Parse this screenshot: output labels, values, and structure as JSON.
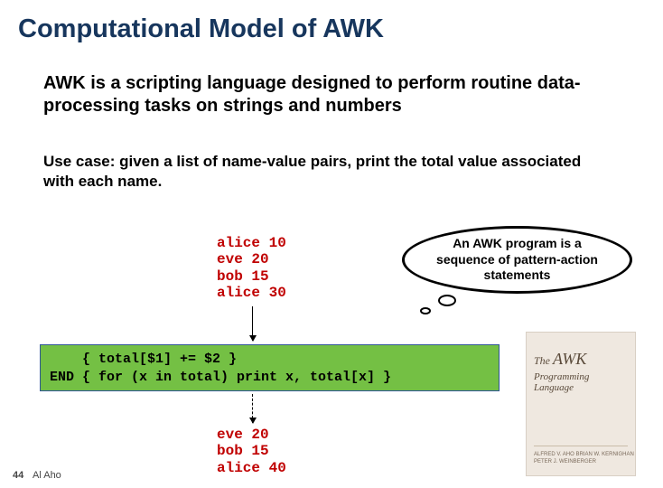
{
  "title": "Computational Model of AWK",
  "description": "AWK is a scripting language designed to perform routine data-processing tasks on strings and numbers",
  "use_case": "Use case: given a list of name-value pairs, print the total value associated with each name.",
  "input_data": "alice 10\neve 20\nbob 15\nalice 30",
  "callout": "An AWK program is a sequence of pattern-action statements",
  "code": "    { total[$1] += $2 }\nEND { for (x in total) print x, total[x] }",
  "output_data": "eve 20\nbob 15\nalice 40",
  "book": {
    "brand": "",
    "the": "The",
    "name": "AWK",
    "sub": "Programming Language",
    "authors": "ALFRED V. AHO\nBRIAN W. KERNIGHAN\nPETER J. WEINBERGER"
  },
  "page_number": "44",
  "author": "Al Aho"
}
